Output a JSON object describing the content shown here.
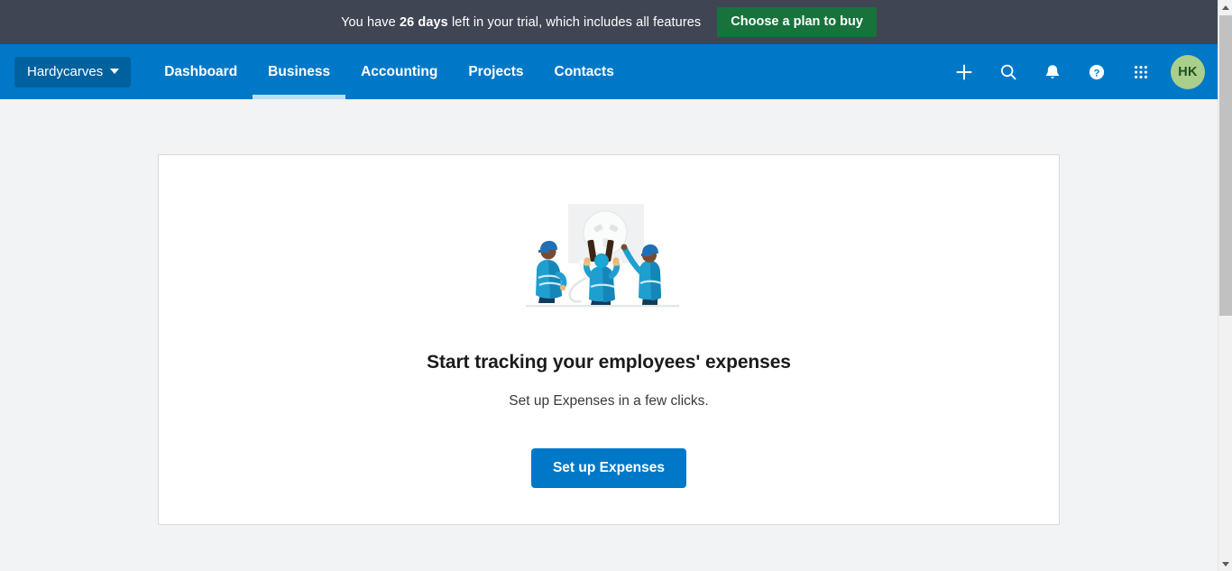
{
  "trial_banner": {
    "text_before": "You have ",
    "days": "26 days",
    "text_after": " left in your trial, which includes all features",
    "cta_label": "Choose a plan to buy",
    "background_color": "#3f4553",
    "cta_color": "#17733b"
  },
  "navbar": {
    "org_name": "Hardycarves",
    "background_color": "#0078c8",
    "active_tab": "Business",
    "links": [
      {
        "label": "Dashboard"
      },
      {
        "label": "Business"
      },
      {
        "label": "Accounting"
      },
      {
        "label": "Projects"
      },
      {
        "label": "Contacts"
      }
    ],
    "icons": [
      {
        "name": "plus-icon"
      },
      {
        "name": "search-icon"
      },
      {
        "name": "notifications-bell-icon"
      },
      {
        "name": "help-icon"
      },
      {
        "name": "apps-grid-icon"
      }
    ],
    "avatar_initials": "HK",
    "avatar_color": "#a9cf8a"
  },
  "main_card": {
    "illustration_name": "plug-and-socket-illustration",
    "title": "Start tracking your employees' expenses",
    "subtitle": "Set up Expenses in a few clicks.",
    "button_label": "Set up Expenses",
    "button_color": "#0078c8"
  },
  "scrollbar": {
    "up_arrow": "scroll-up-arrow",
    "down_arrow": "scroll-down-arrow"
  }
}
